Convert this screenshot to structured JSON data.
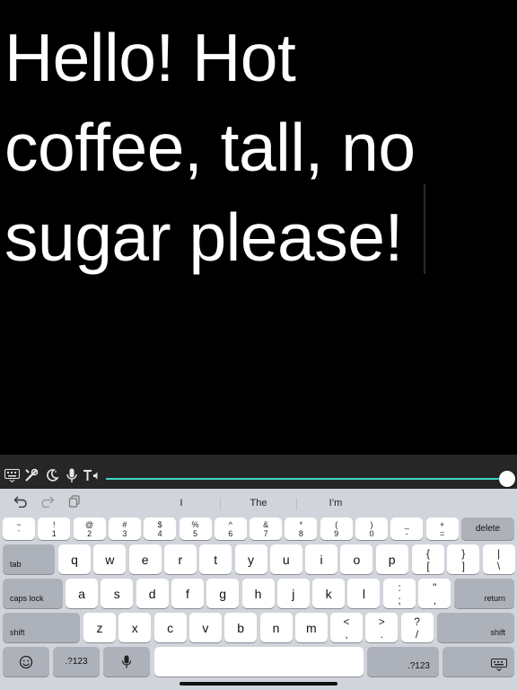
{
  "display": {
    "text": "Hello! Hot coffee, tall, no sugar please!"
  },
  "toolbar": {
    "icons": [
      "keyboard-icon",
      "tools-icon",
      "night-mode-icon",
      "microphone-icon",
      "text-to-speech-icon"
    ],
    "accent_color": "#3fd7c7"
  },
  "suggestions": {
    "words": [
      "I",
      "The",
      "I’m"
    ]
  },
  "keyboard": {
    "number_row": [
      {
        "top": "~",
        "bot": "`"
      },
      {
        "top": "!",
        "bot": "1"
      },
      {
        "top": "@",
        "bot": "2"
      },
      {
        "top": "#",
        "bot": "3"
      },
      {
        "top": "$",
        "bot": "4"
      },
      {
        "top": "%",
        "bot": "5"
      },
      {
        "top": "^",
        "bot": "6"
      },
      {
        "top": "&",
        "bot": "7"
      },
      {
        "top": "*",
        "bot": "8"
      },
      {
        "top": "(",
        "bot": "9"
      },
      {
        "top": ")",
        "bot": "0"
      },
      {
        "top": "_",
        "bot": "-"
      },
      {
        "top": "+",
        "bot": "="
      }
    ],
    "delete": "delete",
    "tab": "tab",
    "row1": [
      "q",
      "w",
      "e",
      "r",
      "t",
      "y",
      "u",
      "i",
      "o",
      "p"
    ],
    "row1_extra": [
      {
        "top": "{",
        "bot": "["
      },
      {
        "top": "}",
        "bot": "]"
      },
      {
        "top": "|",
        "bot": "\\"
      }
    ],
    "caps": "caps lock",
    "row2": [
      "a",
      "s",
      "d",
      "f",
      "g",
      "h",
      "j",
      "k",
      "l"
    ],
    "row2_extra": [
      {
        "top": ":",
        "bot": ";"
      },
      {
        "top": "\"",
        "bot": ","
      }
    ],
    "return": "return",
    "shift": "shift",
    "row3": [
      "z",
      "x",
      "c",
      "v",
      "b",
      "n",
      "m"
    ],
    "row3_extra": [
      {
        "top": "<",
        "bot": ","
      },
      {
        "top": ">",
        "bot": "."
      },
      {
        "top": "?",
        "bot": "/"
      }
    ],
    "numbers_label": ".?123"
  }
}
